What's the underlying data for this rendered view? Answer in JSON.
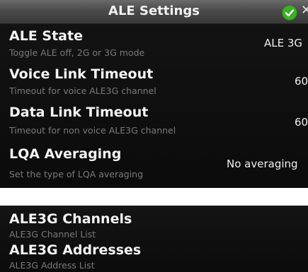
{
  "header": {
    "title": "ALE Settings",
    "confirm_icon": "checkmark-icon",
    "close_icon": "close-icon",
    "accent": "#3fae2a"
  },
  "settings": [
    {
      "title": "ALE State",
      "subtitle": "Toggle ALE off, 2G or 3G mode",
      "value": "ALE 3G"
    },
    {
      "title": "Voice Link Timeout",
      "subtitle": "Timeout for voice ALE3G channel",
      "value": "60"
    },
    {
      "title": "Data Link Timeout",
      "subtitle": "Timeout for non voice ALE3G channel",
      "value": "60"
    },
    {
      "title": "LQA Averaging",
      "subtitle": "Set the type of LQA averaging",
      "value": "No averaging"
    }
  ],
  "lists": [
    {
      "title": "ALE3G Channels",
      "subtitle": "ALE3G Channel List"
    },
    {
      "title": "ALE3G Addresses",
      "subtitle": "ALE3G Address List"
    }
  ]
}
